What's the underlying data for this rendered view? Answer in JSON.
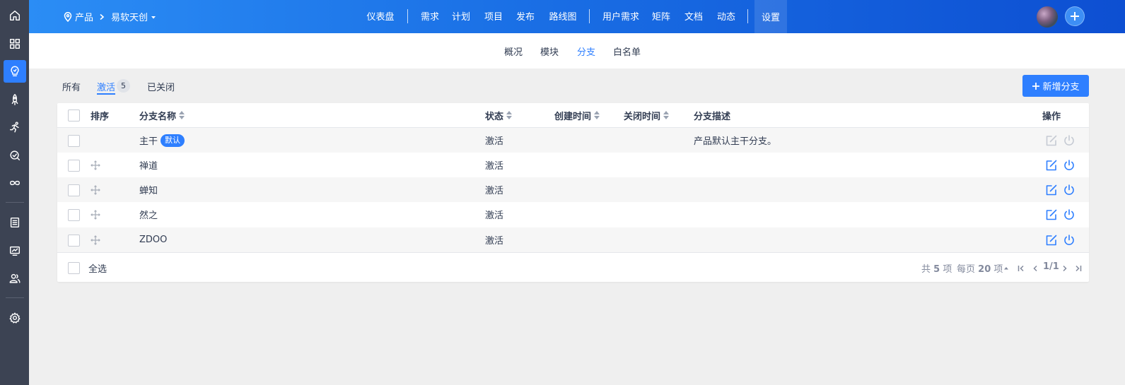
{
  "breadcrumb": {
    "product_label": "产品",
    "current_product": "易软天创"
  },
  "top_nav": {
    "items": [
      "仪表盘",
      "需求",
      "计划",
      "项目",
      "发布",
      "路线图",
      "用户需求",
      "矩阵",
      "文档",
      "动态",
      "设置"
    ],
    "active": "设置"
  },
  "sub_nav": {
    "items": [
      "概况",
      "模块",
      "分支",
      "白名单"
    ],
    "active": "分支"
  },
  "tabs": {
    "all": "所有",
    "active": "激活",
    "active_count": "5",
    "closed": "已关闭"
  },
  "new_branch_button": "新增分支",
  "table": {
    "headers": {
      "order": "排序",
      "name": "分支名称",
      "status": "状态",
      "created": "创建时间",
      "closed": "关闭时间",
      "desc": "分支描述",
      "actions": "操作"
    },
    "rows": [
      {
        "name": "主干",
        "badge": "默认",
        "status": "激活",
        "created": "",
        "closed": "",
        "desc": "产品默认主干分支。"
      },
      {
        "name": "禅道",
        "status": "激活",
        "created": "",
        "closed": "",
        "desc": ""
      },
      {
        "name": "蝉知",
        "status": "激活",
        "created": "",
        "closed": "",
        "desc": ""
      },
      {
        "name": "然之",
        "status": "激活",
        "created": "",
        "closed": "",
        "desc": ""
      },
      {
        "name": "ZDOO",
        "status": "激活",
        "created": "",
        "closed": "",
        "desc": ""
      }
    ]
  },
  "footer": {
    "select_all": "全选",
    "total_prefix": "共",
    "total": "5",
    "total_suffix": "项",
    "per_page_prefix": "每页",
    "per_page": "20",
    "per_page_suffix": "项",
    "page": "1/1"
  },
  "colors": {
    "accent": "#2e7fff",
    "rail": "#3c4353"
  }
}
